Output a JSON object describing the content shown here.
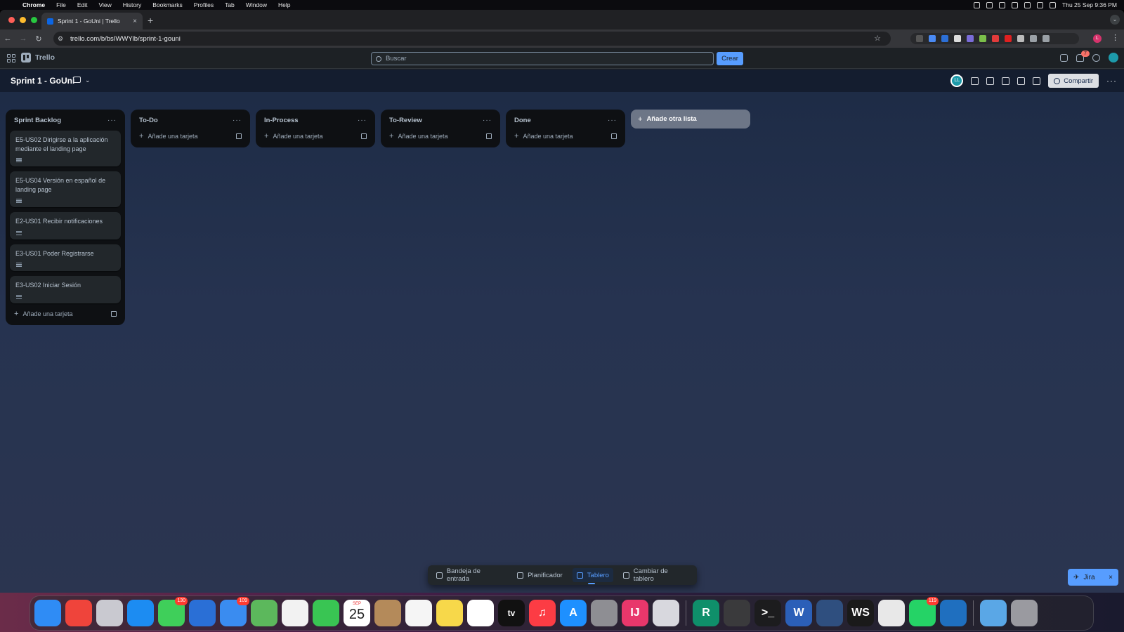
{
  "menubar": {
    "items": [
      "Chrome",
      "File",
      "Edit",
      "View",
      "History",
      "Bookmarks",
      "Profiles",
      "Tab",
      "Window",
      "Help"
    ],
    "clock": "Thu 25 Sep  9:36 PM"
  },
  "browser": {
    "tab_title": "Sprint 1 - GoUni | Trello",
    "url": "trello.com/b/bsIWWYlb/sprint-1-gouni",
    "profile_initial": "L",
    "colors": {
      "close": "#ff5f57",
      "minimize": "#febc2e",
      "maximize": "#28c840"
    }
  },
  "trello": {
    "logo_text": "Trello",
    "search_placeholder": "Buscar",
    "create_label": "Crear",
    "notification_count": "7",
    "accent": "#579dff"
  },
  "board": {
    "title": "Sprint 1 - GoUni",
    "member_initials": "LL",
    "share_label": "Compartir",
    "lists": [
      {
        "title": "Sprint Backlog",
        "cards": [
          {
            "title": "E5-US02 Dirigirse a la aplicación mediante el landing page"
          },
          {
            "title": "E5-US04 Versión en español de landing page"
          },
          {
            "title": "E2-US01 Recibir notificaciones"
          },
          {
            "title": "E3-US01 Poder Registrarse"
          },
          {
            "title": "E3-US02 Iniciar Sesión"
          }
        ],
        "add_card_label": "Añade una tarjeta"
      },
      {
        "title": "To-Do",
        "cards": [],
        "add_card_label": "Añade una tarjeta"
      },
      {
        "title": "In-Process",
        "cards": [],
        "add_card_label": "Añade una tarjeta"
      },
      {
        "title": "To-Review",
        "cards": [],
        "add_card_label": "Añade una tarjeta"
      },
      {
        "title": "Done",
        "cards": [],
        "add_card_label": "Añade una tarjeta"
      }
    ],
    "add_list_label": "Añade otra lista"
  },
  "switcher": {
    "items": [
      {
        "label": "Bandeja de entrada",
        "icon": "inbox-icon"
      },
      {
        "label": "Planificador",
        "icon": "calendar-icon"
      },
      {
        "label": "Tablero",
        "icon": "board-icon",
        "active": true
      },
      {
        "label": "Cambiar de tablero",
        "icon": "switch-board-icon"
      }
    ]
  },
  "jira": {
    "label": "Jira"
  },
  "dock": {
    "apps": [
      {
        "name": "finder",
        "color": "#2f8cf5"
      },
      {
        "name": "anydesk",
        "color": "#ef443b"
      },
      {
        "name": "launchpad",
        "color": "#c9c9d0"
      },
      {
        "name": "safari",
        "color": "#1c8cf2"
      },
      {
        "name": "messages",
        "color": "#3fcf5a",
        "badge": "130"
      },
      {
        "name": "xcode-tools",
        "color": "#2a6fd6"
      },
      {
        "name": "mail",
        "color": "#3a8cf0",
        "badge": "109"
      },
      {
        "name": "maps",
        "color": "#5cb85c"
      },
      {
        "name": "photos",
        "color": "#f2f2f2"
      },
      {
        "name": "facetime",
        "color": "#39c553"
      },
      {
        "name": "calendar",
        "color": "#ffffff",
        "month": "SEP",
        "day": "25"
      },
      {
        "name": "contacts",
        "color": "#b48a5a"
      },
      {
        "name": "reminders",
        "color": "#f5f5f5"
      },
      {
        "name": "notes",
        "color": "#f7d84a"
      },
      {
        "name": "freeform",
        "color": "#ffffff"
      },
      {
        "name": "apple-tv",
        "color": "#111111",
        "glyph": "tv"
      },
      {
        "name": "music",
        "color": "#fc3c44",
        "glyph": "♫"
      },
      {
        "name": "app-store",
        "color": "#1e90ff",
        "glyph": "A"
      },
      {
        "name": "system-settings",
        "color": "#8e8e93"
      },
      {
        "name": "intellij",
        "color": "#e8376b",
        "glyph": "IJ"
      },
      {
        "name": "instruments",
        "color": "#d8d8de"
      },
      {
        "name": "rider",
        "color": "#0f8f6a",
        "glyph": "R"
      },
      {
        "name": "calculator",
        "color": "#3a3a3c"
      },
      {
        "name": "terminal",
        "color": "#1c1c1e",
        "glyph": ">_"
      },
      {
        "name": "word",
        "color": "#2b5fb8",
        "glyph": "W"
      },
      {
        "name": "mysql-workbench",
        "color": "#2f4f7f"
      },
      {
        "name": "webstorm",
        "color": "#1a1a1a",
        "glyph": "WS"
      },
      {
        "name": "chrome",
        "color": "#e8e8e8"
      },
      {
        "name": "whatsapp",
        "color": "#25d366",
        "badge": "119"
      },
      {
        "name": "vscode",
        "color": "#1f6fbf"
      },
      {
        "name": "downloads-folder",
        "color": "#5aa7e6"
      },
      {
        "name": "trash",
        "color": "#9a9aa0"
      }
    ]
  }
}
